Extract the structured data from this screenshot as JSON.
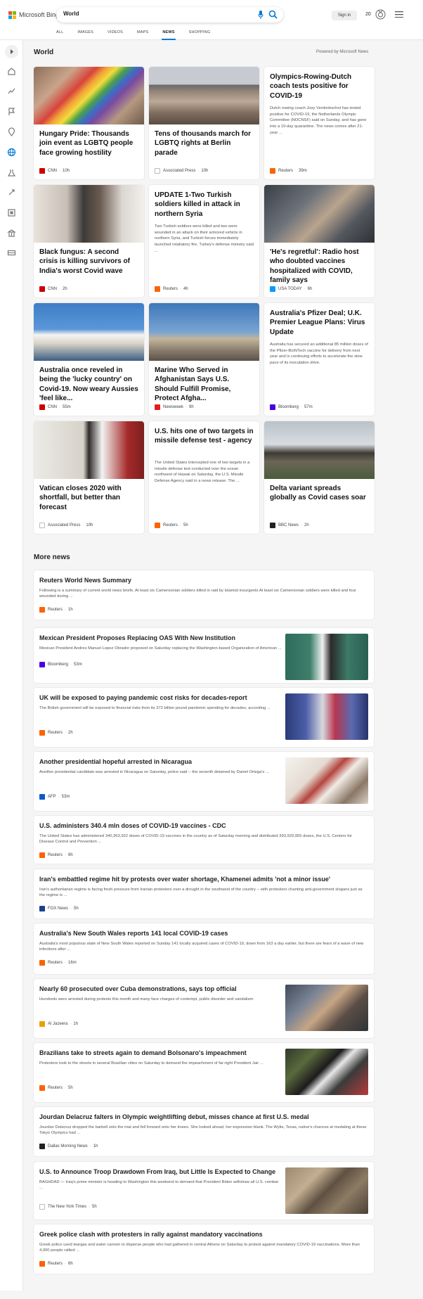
{
  "header": {
    "brand": "Microsoft Bing",
    "query": "World",
    "signin": "Sign in",
    "points": "20",
    "tabs": [
      "ALL",
      "IMAGES",
      "VIDEOS",
      "MAPS",
      "NEWS",
      "SHOPPING"
    ],
    "active_tab": "NEWS"
  },
  "section": {
    "title": "World",
    "powered": "Powered by Microsoft News"
  },
  "cards": [
    {
      "title": "Hungary Pride: Thousands join event as LGBTQ people face growing hostility",
      "snippet": "",
      "source": "CNN",
      "time": "10h",
      "logo_color": "#cc0000",
      "img": "crowd-rainbow"
    },
    {
      "title": "Tens of thousands march for LGBTQ rights at Berlin parade",
      "snippet": "",
      "source": "Associated Press",
      "time": "10h",
      "logo_color": "#ffffff",
      "img": "crowd-berlin"
    },
    {
      "title": "Olympics-Rowing-Dutch coach tests positive for COVID-19",
      "snippet": "Dutch rowing coach Josy Verdonkschot has tested positive for COVID-19, the Netherlands Olympic Committee (NOCNSF) said on Sunday, and has gone into a 10-day quarantine. The news comes after 21-year ...",
      "source": "Reuters",
      "time": "39m",
      "logo_color": "#fa6400",
      "img": ""
    },
    {
      "title": "Black fungus: A second crisis is killing survivors of India's worst Covid wave",
      "snippet": "",
      "source": "CNN",
      "time": "2h",
      "logo_color": "#cc0000",
      "img": "hospital"
    },
    {
      "title": "UPDATE 1-Two Turkish soldiers killed in attack in northern Syria",
      "snippet": "Two Turkish soldiers were killed and two were wounded in an attack on their armored vehicle in northern Syria, and Turkish forces immediately launched retaliatory fire, Turkey's defense ministry said ...",
      "source": "Reuters",
      "time": "4h",
      "logo_color": "#fa6400",
      "img": ""
    },
    {
      "title": "'He's regretful': Radio host who doubted vaccines hospitalized with COVID, family says",
      "snippet": "",
      "source": "USA TODAY",
      "time": "6h",
      "logo_color": "#009bff",
      "img": "radio"
    },
    {
      "title": "Australia once reveled in being the 'lucky country' on Covid-19. Now weary Aussies 'feel like...",
      "snippet": "",
      "source": "CNN",
      "time": "55m",
      "logo_color": "#cc0000",
      "img": "opera"
    },
    {
      "title": "Marine Who Served in Afghanistan Says U.S. Should Fulfill Promise, Protect Afgha...",
      "snippet": "",
      "source": "Newsweek",
      "time": "9h",
      "logo_color": "#e11d1d",
      "img": "plane"
    },
    {
      "title": "Australia's Pfizer Deal; U.K. Premier League Plans: Virus Update",
      "snippet": "Australia has secured an additional 85 million doses of the Pfizer-BioNTech vaccine for delivery from next year and is continuing efforts to accelerate the slow pace of its inoculation drive.",
      "source": "Bloomberg",
      "time": "57m",
      "logo_color": "#4a00e0",
      "img": ""
    },
    {
      "title": "Vatican closes 2020 with shortfall, but better than forecast",
      "snippet": "",
      "source": "Associated Press",
      "time": "10h",
      "logo_color": "#ffffff",
      "img": "pope"
    },
    {
      "title": "U.S. hits one of two targets in missile defense test - agency",
      "snippet": "The United States intercepted one of two targets in a missile defense test conducted over the ocean northwest of Hawaii on Saturday, the U.S. Missile Defense Agency said in a news release. The ...",
      "source": "Reuters",
      "time": "5h",
      "logo_color": "#fa6400",
      "img": ""
    },
    {
      "title": "Delta variant spreads globally as Covid cases soar",
      "snippet": "",
      "source": "BBC News",
      "time": "2h",
      "logo_color": "#222222",
      "img": "graves"
    }
  ],
  "more": {
    "title": "More news",
    "items": [
      {
        "title": "Reuters World News Summary",
        "snippet": "Following is a summary of current world news briefs. At least six Cameroonian soldiers killed in raid by Islamist insurgents At least six Cameroonian soldiers were killed and four wounded during ...",
        "source": "Reuters",
        "time": "1h",
        "logo_color": "#fa6400",
        "thumb": ""
      },
      {
        "title": "Mexican President Proposes Replacing OAS With New Institution",
        "snippet": "Mexican President Andres Manuel Lopez Obrador proposed on Saturday replacing the Washington-based Organization of American ...",
        "source": "Bloomberg",
        "time": "53m",
        "logo_color": "#4a00e0",
        "thumb": "mexico"
      },
      {
        "title": "UK will be exposed to paying pandemic cost risks for decades-report",
        "snippet": "The British government will be exposed to financial risks from its 372 billion pound pandemic spending for decades, according ...",
        "source": "Reuters",
        "time": "2h",
        "logo_color": "#fa6400",
        "thumb": "train"
      },
      {
        "title": "Another presidential hopeful arrested in Nicaragua",
        "snippet": "Another presidential candidate was arrested in Nicaragua on Saturday, police said -- the seventh detained by Daniel Ortega's ...",
        "source": "AFP",
        "time": "53m",
        "logo_color": "#0c5ac8",
        "thumb": "speaker"
      },
      {
        "title": "U.S. administers 340.4 mln doses of COVID-19 vaccines - CDC",
        "snippet": "The United States has administered 340,363,922 doses of COVID-19 vaccines in the country as of Saturday morning and distributed 393,929,955 doses, the U.S. Centers for Disease Control and Prevention ...",
        "source": "Reuters",
        "time": "6h",
        "logo_color": "#fa6400",
        "thumb": ""
      },
      {
        "title": "Iran's embattled regime hit by protests over water shortage, Khamenei admits 'not a minor issue'",
        "snippet": "Iran's authoritarian regime is facing fresh pressure from Iranian protesters over a drought in the southwest of the country -- with protesters chanting anti-government slogans just as the regime is ...",
        "source": "FOX News",
        "time": "5h",
        "logo_color": "#1d3f8f",
        "thumb": ""
      },
      {
        "title": "Australia's New South Wales reports 141 local COVID-19 cases",
        "snippet": "Australia's most populous state of New South Wales reported on Sunday 141 locally acquired cases of COVID-19, down from 163 a day earlier, but there are fears of a wave of new infections after ...",
        "source": "Reuters",
        "time": "16m",
        "logo_color": "#fa6400",
        "thumb": ""
      },
      {
        "title": "Nearly 60 prosecuted over Cuba demonstrations, says top official",
        "snippet": "Hundreds were arrested during protests this month and many face charges of contempt, public disorder and vandalism.",
        "source": "Al Jazeera",
        "time": "1h",
        "logo_color": "#e9a000",
        "thumb": "cuba"
      },
      {
        "title": "Brazilians take to streets again to demand Bolsonaro's impeachment",
        "snippet": "Protesters took to the streets in several Brazilian cities on Saturday to demand the impeachment of far-right President Jair ...",
        "source": "Reuters",
        "time": "5h",
        "logo_color": "#fa6400",
        "thumb": "brazil"
      },
      {
        "title": "Jourdan Delacruz falters in Olympic weightlifting debut, misses chance at first U.S. medal",
        "snippet": "Jourdan Delacruz dropped the barbell onto the mat and fell forward onto her knees. She looked ahead, her expression blank. The Wylie, Texas, native's chances at medaling at these Tokyo Olympics had ...",
        "source": "Dallas Morning News",
        "time": "1h",
        "logo_color": "#222222",
        "thumb": ""
      },
      {
        "title": "U.S. to Announce Troop Drawdown From Iraq, but Little Is Expected to Change",
        "snippet": "BAGHDAD — Iraq's prime minister is heading to Washington this weekend to demand that President Biden withdraw all U.S. combat ...",
        "source": "The New York Times",
        "time": "5h",
        "logo_color": "#ffffff",
        "thumb": "iraq"
      },
      {
        "title": "Greek police clash with protesters in rally against mandatory vaccinations",
        "snippet": "Greek police used teargas and water cannon to disperse people who had gathered in central Athens on Saturday to protest against mandatory COVID-19 vaccinations. More than 4,000 people rallied ...",
        "source": "Reuters",
        "time": "6h",
        "logo_color": "#fa6400",
        "thumb": ""
      }
    ]
  }
}
